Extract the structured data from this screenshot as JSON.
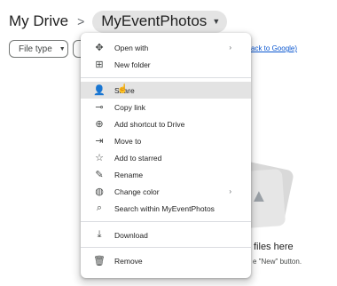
{
  "breadcrumb": {
    "root": "My Drive",
    "separator": ">",
    "current": "MyEventPhotos"
  },
  "filters": {
    "type_label": "File type"
  },
  "back_link": "ack to Google)",
  "empty_state": {
    "title": "files here",
    "subtitle": "e \"New\" button."
  },
  "context_menu": {
    "open_with": "Open with",
    "new_folder": "New folder",
    "share": "Share",
    "copy_link": "Copy link",
    "add_shortcut": "Add shortcut to Drive",
    "move_to": "Move to",
    "add_starred": "Add to starred",
    "rename": "Rename",
    "change_color": "Change color",
    "search_within": "Search within MyEventPhotos",
    "download": "Download",
    "remove": "Remove"
  },
  "colors": {
    "link": "#0b57d0",
    "hover": "#e3e3e3",
    "chip_bg": "#e4e4e4"
  }
}
